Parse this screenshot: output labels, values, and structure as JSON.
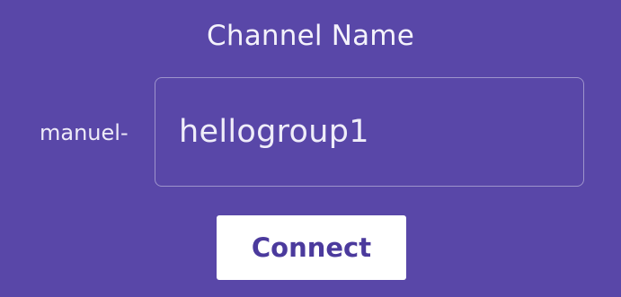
{
  "form": {
    "title": "Channel Name",
    "prefix": "manuel-",
    "channel_value": "hellogroup1",
    "connect_label": "Connect"
  },
  "colors": {
    "background": "#5947a8",
    "button_background": "#ffffff",
    "button_text": "#4b3a9d",
    "text": "#f4f2fb"
  }
}
